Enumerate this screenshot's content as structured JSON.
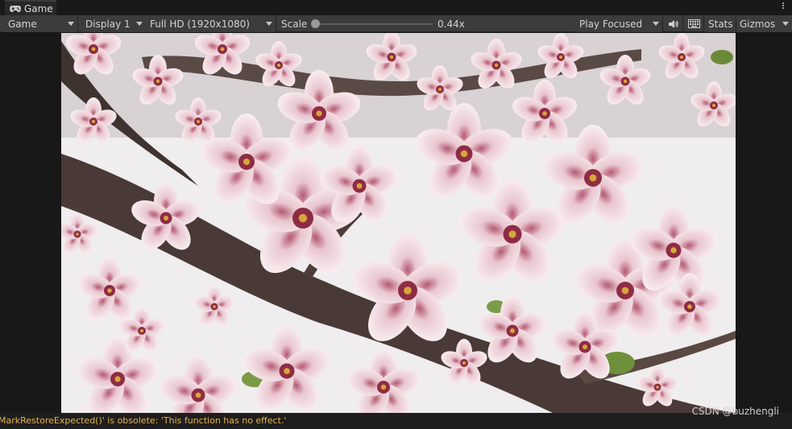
{
  "window": {
    "tab_label": "Game",
    "tab_icon": "gamepad-icon"
  },
  "toolbar": {
    "view_mode": "Game",
    "display": "Display 1",
    "resolution": "Full HD (1920x1080)",
    "scale_label": "Scale",
    "scale_value": "0.44x",
    "scale_level": 0.44,
    "play_mode": "Play Focused",
    "audio_icon": "speaker-icon",
    "keyboard_icon": "keyboard-icon",
    "stats_label": "Stats",
    "gizmos_label": "Gizmos"
  },
  "status": {
    "message": "MarkRestoreExpected()' is obsolete: 'This function has no effect.'",
    "color": "#e7b34b"
  },
  "watermark": "CSDN @buzhengli",
  "colors": {
    "toolbar_bg": "#3c3c3c",
    "panel_bg": "#191919",
    "warning": "#e7b34b"
  }
}
